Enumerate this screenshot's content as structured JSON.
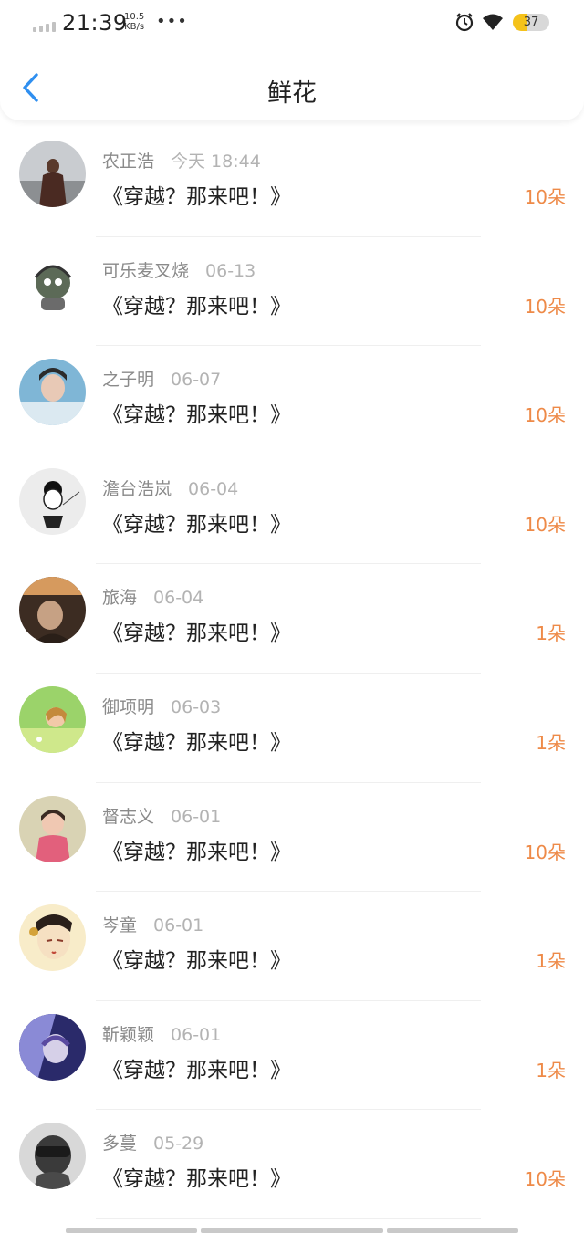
{
  "status_bar": {
    "time": "21:39",
    "speed_value": "10.5",
    "speed_unit": "KB/s",
    "more": "•••",
    "battery": "37",
    "battery_color": "#f5c21a"
  },
  "header": {
    "title": "鲜花",
    "back_icon": "chevron-left-icon",
    "accent": "#2f8ff0"
  },
  "count_color": "#ee8a48",
  "flowers": [
    {
      "name": "农正浩",
      "date": "今天 18:44",
      "title": "《穿越？那来吧！》",
      "count": "10朵"
    },
    {
      "name": "可乐麦叉烧",
      "date": "06-13",
      "title": "《穿越？那来吧！》",
      "count": "10朵"
    },
    {
      "name": "之子明",
      "date": "06-07",
      "title": "《穿越？那来吧！》",
      "count": "10朵"
    },
    {
      "name": "澹台浩岚",
      "date": "06-04",
      "title": "《穿越？那来吧！》",
      "count": "10朵"
    },
    {
      "name": "旅海",
      "date": "06-04",
      "title": "《穿越？那来吧！》",
      "count": "1朵"
    },
    {
      "name": "御项明",
      "date": "06-03",
      "title": "《穿越？那来吧！》",
      "count": "1朵"
    },
    {
      "name": "督志义",
      "date": "06-01",
      "title": "《穿越？那来吧！》",
      "count": "10朵"
    },
    {
      "name": "岑童",
      "date": "06-01",
      "title": "《穿越？那来吧！》",
      "count": "1朵"
    },
    {
      "name": "靳颖颖",
      "date": "06-01",
      "title": "《穿越？那来吧！》",
      "count": "1朵"
    },
    {
      "name": "多蔓",
      "date": "05-29",
      "title": "《穿越？那来吧！》",
      "count": "10朵"
    }
  ]
}
